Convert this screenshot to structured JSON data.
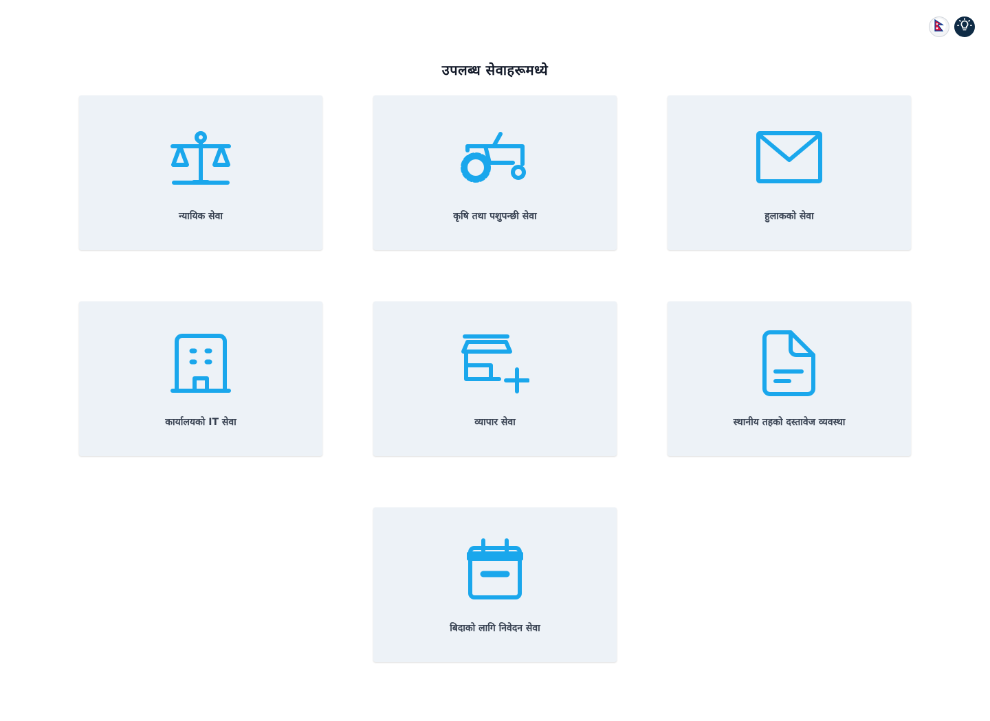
{
  "page": {
    "title": "उपलब्ध सेवाहरूमध्ये"
  },
  "topbar": {
    "language_icon": "nepal-flag-icon",
    "theme_icon": "lightbulb-icon"
  },
  "colors": {
    "accent": "#1aa7ec",
    "card_bg": "#edf2f7",
    "theme_button_bg": "#0f2b45"
  },
  "services": [
    {
      "label": "न्यायिक सेवा",
      "icon": "scales-icon"
    },
    {
      "label": "कृषि तथा पशुपन्छी सेवा",
      "icon": "tractor-icon"
    },
    {
      "label": "हुलाकको सेवा",
      "icon": "mail-icon"
    },
    {
      "label": "कार्यालयको IT सेवा",
      "icon": "building-icon"
    },
    {
      "label": "व्यापार सेवा",
      "icon": "add-store-icon"
    },
    {
      "label": "स्थानीय तहको दस्तावेज व्यवस्था",
      "icon": "document-icon"
    },
    {
      "label": "बिदाको लागि निवेदन सेवा",
      "icon": "calendar-icon"
    }
  ]
}
